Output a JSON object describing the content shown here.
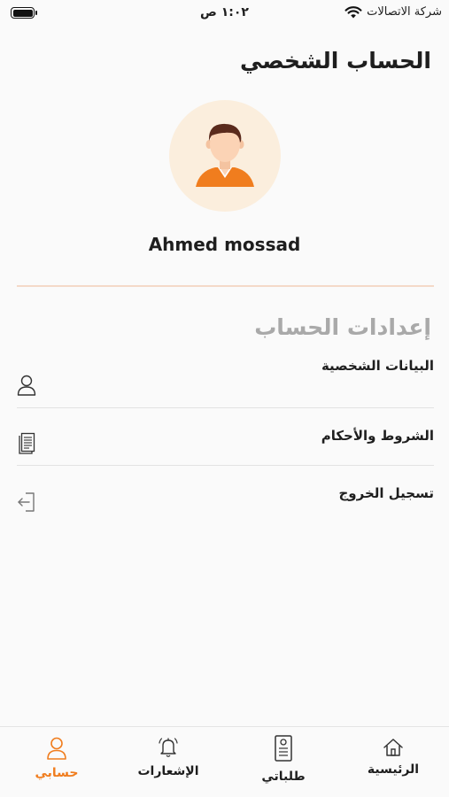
{
  "status_bar": {
    "carrier": "شركة الاتصالات",
    "time": "١:٠٢ ص"
  },
  "page": {
    "title": "الحساب الشخصي"
  },
  "profile": {
    "name": "Ahmed mossad"
  },
  "settings": {
    "title": "إعدادات الحساب",
    "items": [
      {
        "label": "البيانات الشخصية",
        "icon": "user-icon"
      },
      {
        "label": "الشروط والأحكام",
        "icon": "document-icon"
      },
      {
        "label": "تسجيل الخروج",
        "icon": "logout-icon"
      }
    ]
  },
  "bottom_nav": {
    "tabs": [
      {
        "label": "الرئيسية",
        "icon": "home-icon",
        "active": false
      },
      {
        "label": "طلباتي",
        "icon": "orders-icon",
        "active": false
      },
      {
        "label": "الإشعارات",
        "icon": "bell-icon",
        "active": false
      },
      {
        "label": "حسابي",
        "icon": "user-icon",
        "active": true
      }
    ]
  },
  "colors": {
    "accent": "#f07d1e",
    "avatar_bg": "#fbeedd",
    "section_title": "#a9a9a9"
  }
}
